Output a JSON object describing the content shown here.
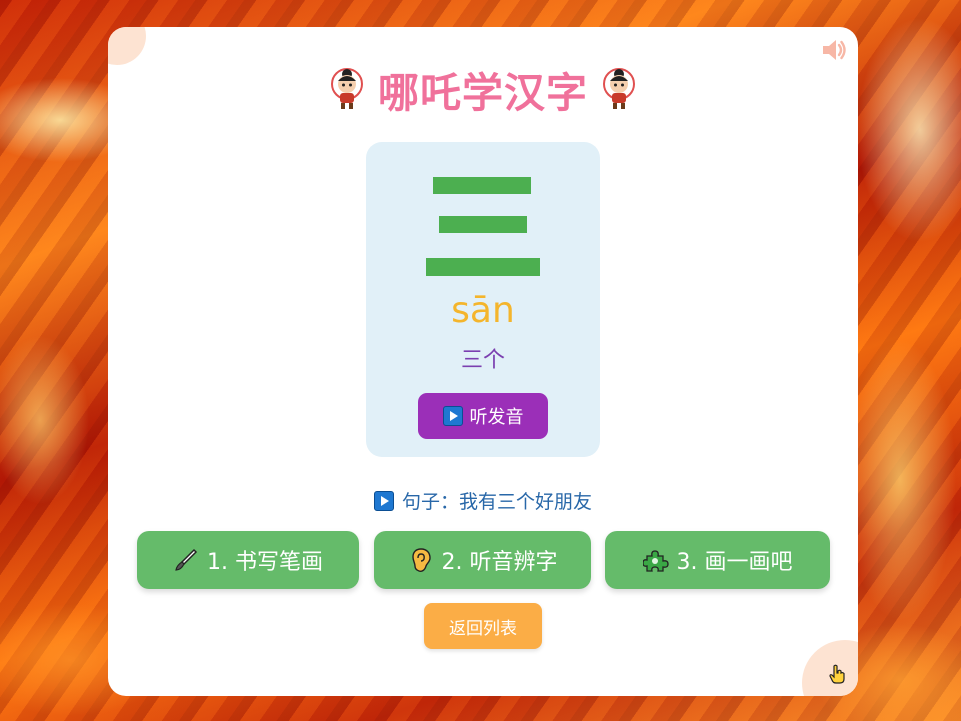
{
  "header": {
    "title": "哪吒学汉字",
    "left_icon": "nezha-mascot-icon",
    "right_icon": "nezha-mascot-icon",
    "sound_icon": "speaker-icon"
  },
  "character_card": {
    "character": "三",
    "pinyin": "sān",
    "word": "三个",
    "listen_button": {
      "icon": "play-icon",
      "label": "听发音"
    }
  },
  "sentence": {
    "icon": "play-icon",
    "label": "句子：我有三个好朋友"
  },
  "actions": [
    {
      "icon": "paintbrush-icon",
      "label": "1. 书写笔画"
    },
    {
      "icon": "ear-icon",
      "label": "2. 听音辨字"
    },
    {
      "icon": "puzzle-icon",
      "label": "3. 画一画吧"
    }
  ],
  "back_button": {
    "label": "返回列表"
  },
  "colors": {
    "title": "#f0719b",
    "stroke": "#4caf50",
    "pinyin": "#f4b52c",
    "word": "#7b3fb0",
    "listen_button": "#9b2fb8",
    "action_button": "#65bb6a",
    "back_button": "#fbad46"
  }
}
